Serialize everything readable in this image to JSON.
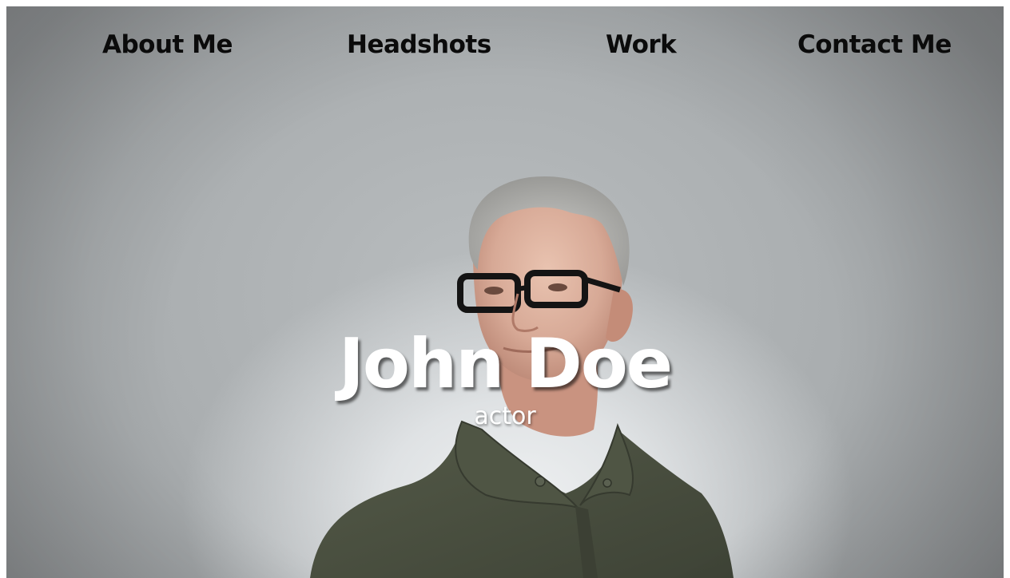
{
  "nav": {
    "items": [
      {
        "label": "About Me"
      },
      {
        "label": "Headshots"
      },
      {
        "label": "Work"
      },
      {
        "label": "Contact Me"
      }
    ]
  },
  "hero": {
    "name": "John Doe",
    "role": "actor",
    "image": "portrait-photo"
  },
  "colors": {
    "nav_text": "#0b0b0b",
    "hero_text": "#ffffff",
    "background": "#a8acae",
    "shirt": "#4b5040"
  }
}
